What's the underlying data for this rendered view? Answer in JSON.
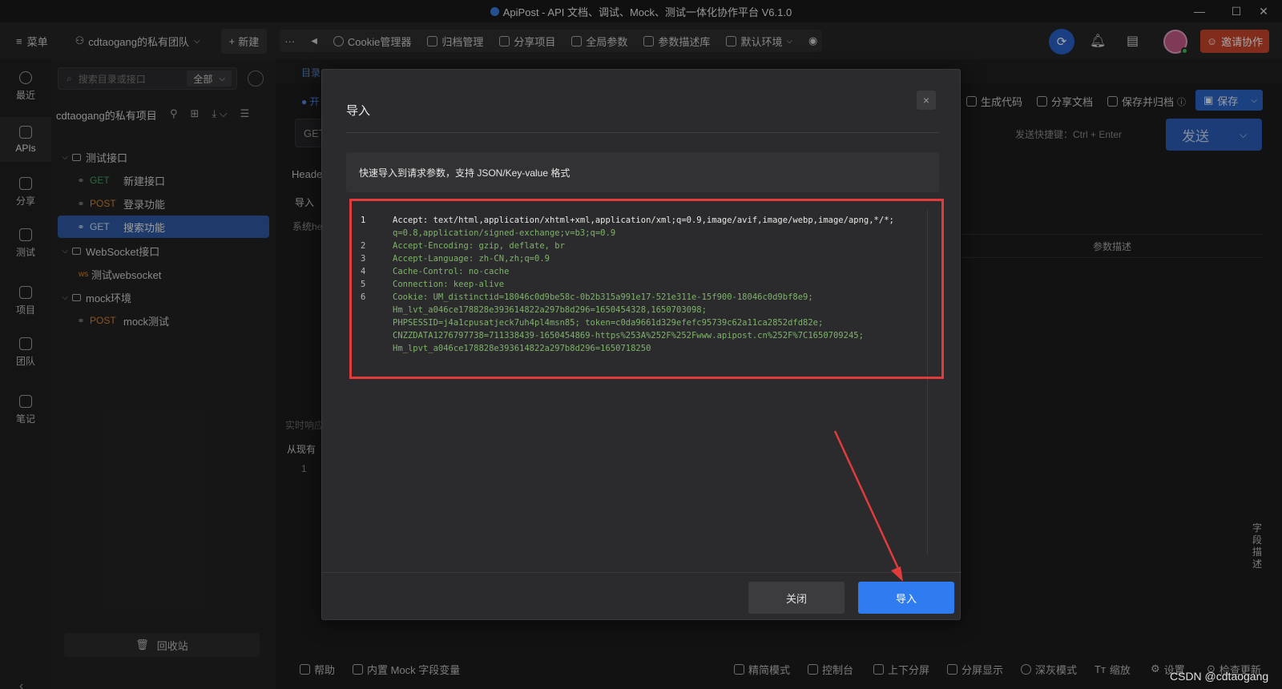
{
  "window": {
    "title": "ApiPost - API 文档、调试、Mock、测试一体化协作平台 V6.1.0"
  },
  "toolbar": {
    "menu_label": "菜单",
    "team_label": "cdtaogang的私有团队",
    "new_label": "新建",
    "more_label": "···",
    "items": [
      "Cookie管理器",
      "归档管理",
      "分享项目",
      "全局参数",
      "参数描述库",
      "默认环境"
    ],
    "invite_label": "邀请协作"
  },
  "rail": {
    "items": [
      "最近",
      "APIs",
      "分享",
      "测试",
      "项目",
      "团队",
      "笔记"
    ]
  },
  "sidebar": {
    "search_placeholder": "搜索目录或接口",
    "filter_label": "全部",
    "project_name": "cdtaogang的私有项目",
    "tree": [
      {
        "kind": "folder",
        "label": "测试接口"
      },
      {
        "kind": "api",
        "method": "GET",
        "label": "新建接口"
      },
      {
        "kind": "api",
        "method": "POST",
        "label": "登录功能"
      },
      {
        "kind": "api",
        "method": "GET",
        "label": "搜索功能",
        "selected": true
      },
      {
        "kind": "folder",
        "label": "WebSocket接口"
      },
      {
        "kind": "ws",
        "method": "ws",
        "label": "测试websocket"
      },
      {
        "kind": "folder",
        "label": "mock环境"
      },
      {
        "kind": "api",
        "method": "POST",
        "label": "mock测试"
      }
    ],
    "recycle_label": "回收站"
  },
  "main": {
    "tab_fragment": "目录",
    "open_fragment": "● 开",
    "url_method": "GET",
    "headers_fragment": "Heade",
    "import_fragment": "导入",
    "system_fragment": "系统he",
    "generate_code": "生成代码",
    "share_doc": "分享文档",
    "save_archive": "保存并归档",
    "save_label": "保存",
    "send_hint": "发送快捷键：Ctrl + Enter",
    "send_label": "发送",
    "param_desc": "参数描述",
    "realtime_fragment": "实时响应",
    "from_existing_fragment": "从现有",
    "line_one": "1",
    "vertical_tab": [
      "字",
      "段",
      "描",
      "述"
    ]
  },
  "statusbar": {
    "items": [
      "帮助",
      "内置 Mock 字段变量",
      "精简模式",
      "控制台",
      "上下分屏",
      "分屏显示",
      "深灰模式",
      "缩放",
      "设置",
      "检查更新"
    ],
    "watermark": "CSDN @cdtaogang"
  },
  "modal": {
    "title": "导入",
    "close_icon": "×",
    "hint": "快速导入到请求参数，支持 JSON/Key-value 格式",
    "code_lines": [
      {
        "n": "1",
        "text": "Accept: text/html,application/xhtml+xml,application/xml;q=0.9,image/avif,image/webp,image/apng,*/*;",
        "first": true
      },
      {
        "n": "",
        "text": "q=0.8,application/signed-exchange;v=b3;q=0.9"
      },
      {
        "n": "2",
        "text": "Accept-Encoding: gzip, deflate, br"
      },
      {
        "n": "3",
        "text": "Accept-Language: zh-CN,zh;q=0.9"
      },
      {
        "n": "4",
        "text": "Cache-Control: no-cache"
      },
      {
        "n": "5",
        "text": "Connection: keep-alive"
      },
      {
        "n": "6",
        "text": "Cookie: UM_distinctid=18046c0d9be58c-0b2b315a991e17-521e311e-15f900-18046c0d9bf8e9;"
      },
      {
        "n": "",
        "text": "Hm_lvt_a046ce178828e393614822a297b8d296=1650454328,1650703098;"
      },
      {
        "n": "",
        "text": "PHPSESSID=j4a1cpusatjeck7uh4pl4msn85; token=c0da9661d329efefc95739c62a11ca2852dfd82e;"
      },
      {
        "n": "",
        "text": "CNZZDATA1276797738=711338439-1650454869-https%253A%252F%252Fwww.apipost.cn%252F%7C1650709245;"
      },
      {
        "n": "",
        "text": "Hm_lpvt_a046ce178828e393614822a297b8d296=1650718250"
      }
    ],
    "close_button": "关闭",
    "import_button": "导入"
  },
  "colors": {
    "accent": "#2f7cf0",
    "highlight": "#e23b3b",
    "get": "#3aa45c",
    "post": "#d9822b",
    "invite": "#c8452c"
  }
}
